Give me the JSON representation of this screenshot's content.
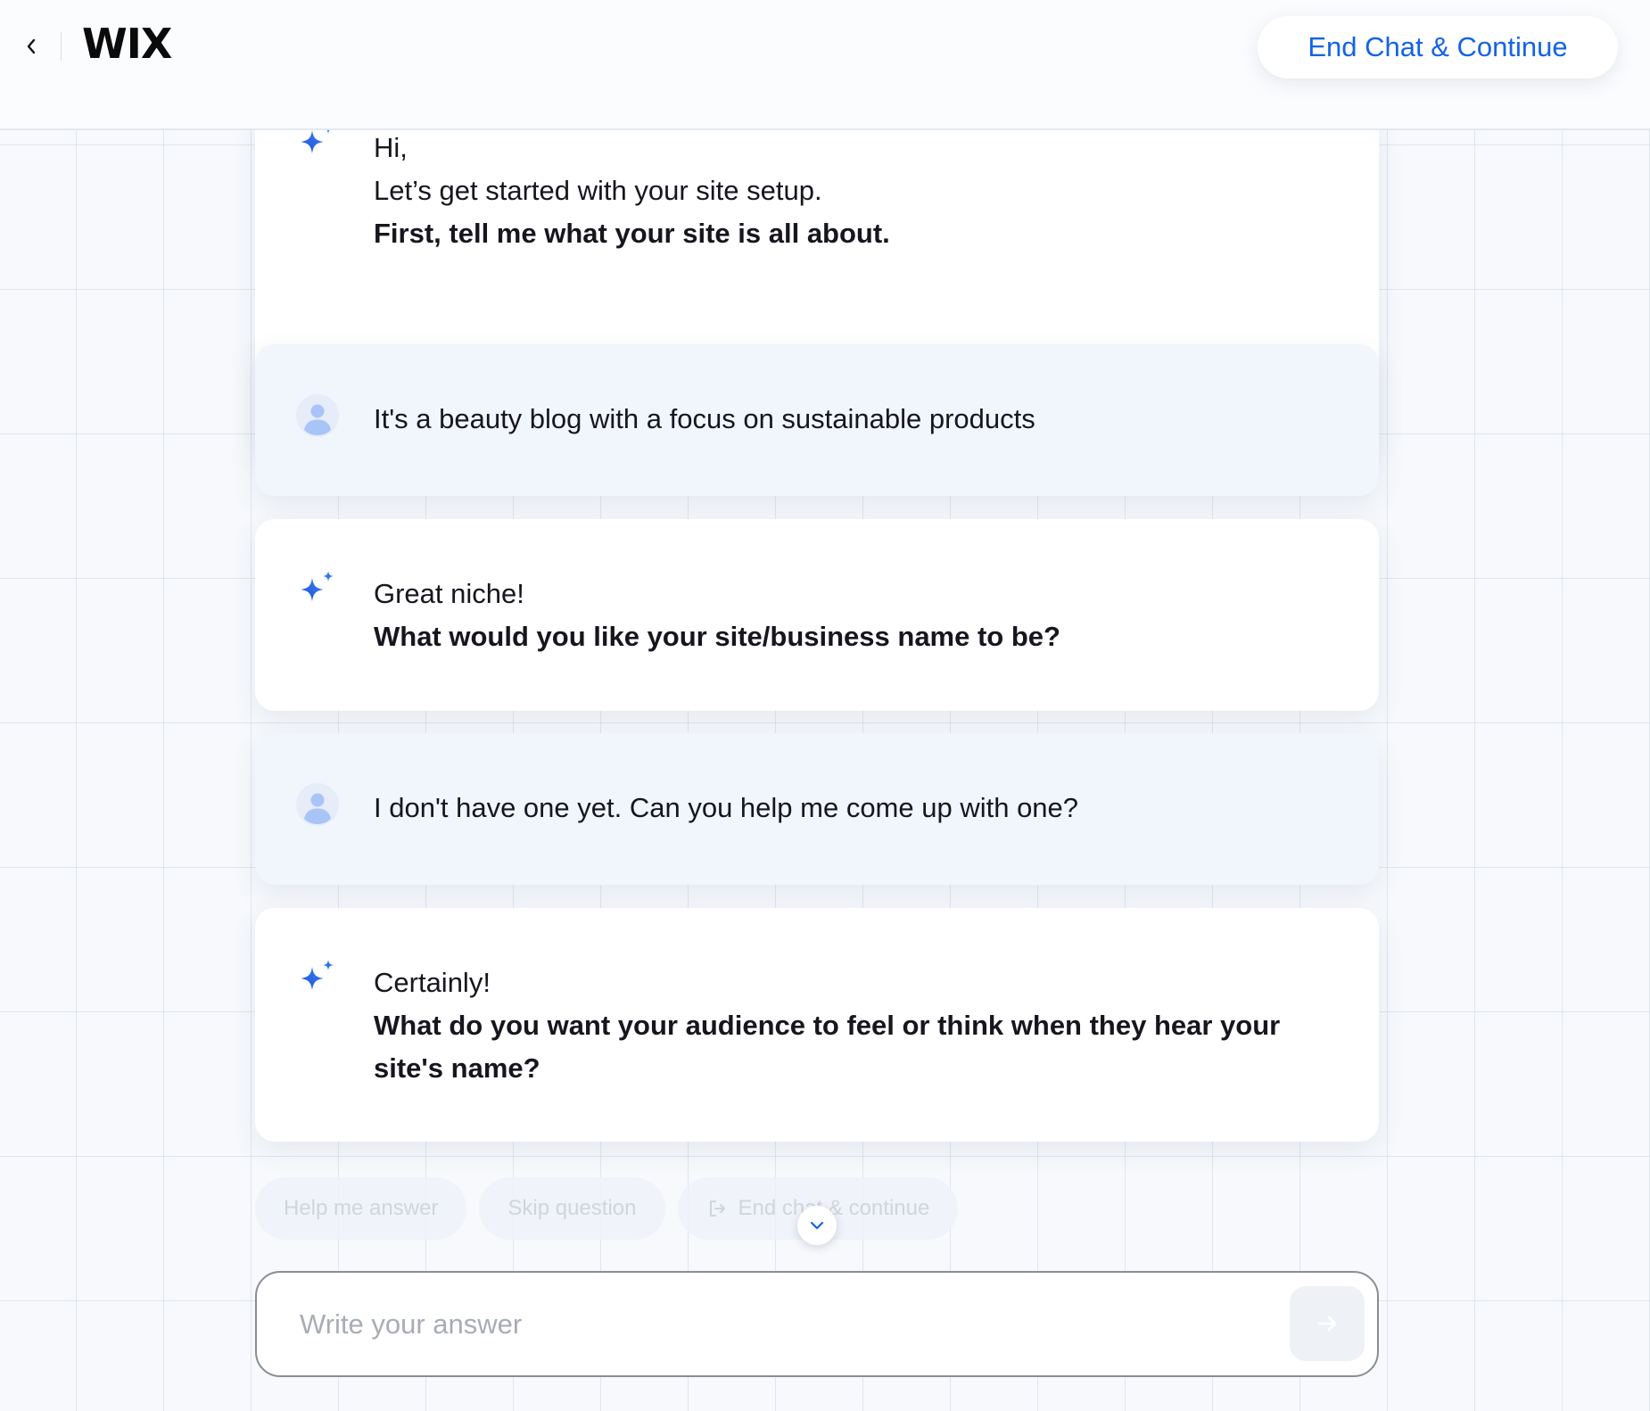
{
  "header": {
    "logo": "WIX",
    "end_chat_button": "End Chat & Continue"
  },
  "messages": [
    {
      "role": "assistant",
      "lines": [
        "Hi,",
        "Let’s get started with your site setup."
      ],
      "bold": "First, tell me what your site is all about."
    },
    {
      "role": "user",
      "text": "It's a beauty blog with a focus on sustainable products"
    },
    {
      "role": "assistant",
      "lines": [
        "Great niche!"
      ],
      "bold": "What would you like your site/business name to be?"
    },
    {
      "role": "user",
      "text": "I don't have one yet. Can you help me come up with one?"
    },
    {
      "role": "assistant",
      "lines": [
        "Certainly!"
      ],
      "bold": "What do you want your audience to feel or think when they hear your site's name?"
    }
  ],
  "quick_actions": {
    "help": "Help me answer",
    "skip": "Skip question",
    "end": "End chat & continue"
  },
  "composer": {
    "placeholder": "Write your answer",
    "value": ""
  },
  "colors": {
    "accent": "#1463e6",
    "user_bubble": "#f1f5fc",
    "ai_bubble": "#ffffff"
  },
  "icons": {
    "ai_avatar": "sparkle-icon",
    "user_avatar": "user-avatar-icon",
    "back": "chevron-left-icon",
    "send": "arrow-right-icon",
    "scroll": "chevron-down-icon",
    "end": "exit-icon"
  }
}
